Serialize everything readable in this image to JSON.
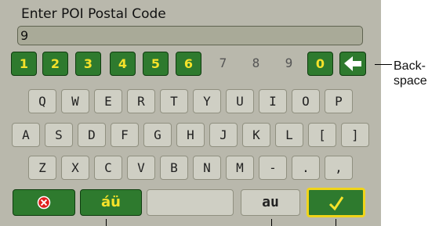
{
  "dialog": {
    "label": "Enter POI Postal Code",
    "input_value": "9"
  },
  "keyboard": {
    "number_row": [
      "1",
      "2",
      "3",
      "4",
      "5",
      "6",
      "7",
      "8",
      "9",
      "0"
    ],
    "row2": [
      "Q",
      "W",
      "E",
      "R",
      "T",
      "Y",
      "U",
      "I",
      "O",
      "P"
    ],
    "row3": [
      "A",
      "S",
      "D",
      "F",
      "G",
      "H",
      "J",
      "K",
      "L",
      "[",
      "]"
    ],
    "row4": [
      "Z",
      "X",
      "C",
      "V",
      "B",
      "N",
      "M",
      "-",
      ".",
      ","
    ],
    "backspace_icon": "left-arrow-icon",
    "accents_label": "áü",
    "abc_label": "au",
    "cancel_icon": "cancel-circle-icon",
    "ok_icon": "checkmark-icon"
  },
  "callouts": {
    "backspace_line1": "Back-",
    "backspace_line2": "space"
  },
  "colors": {
    "screen_bg": "#b9b8ac",
    "active_key": "#2e7a2e",
    "key_text_active": "#f6e22a",
    "inactive_key": "#cfcfc4",
    "ok_border": "#f0d41a"
  }
}
